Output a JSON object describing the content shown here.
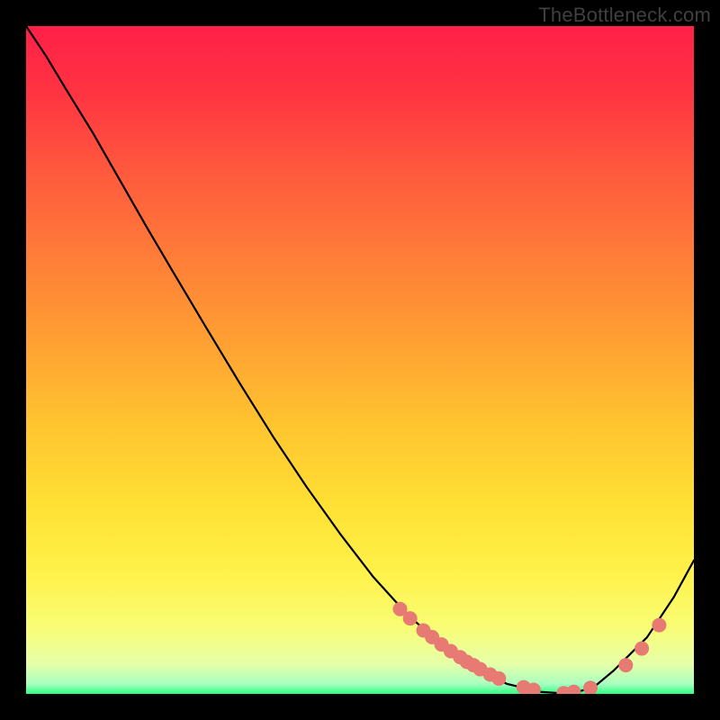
{
  "watermark": "TheBottleneck.com",
  "chart_data": {
    "type": "line",
    "title": "",
    "xlabel": "",
    "ylabel": "",
    "x": [
      0.0,
      0.03,
      0.06,
      0.1,
      0.14,
      0.18,
      0.22,
      0.27,
      0.32,
      0.37,
      0.42,
      0.47,
      0.52,
      0.57,
      0.62,
      0.67,
      0.72,
      0.77,
      0.815,
      0.85,
      0.88,
      0.93,
      0.97,
      1.0
    ],
    "values": [
      1.0,
      0.955,
      0.905,
      0.84,
      0.77,
      0.7,
      0.632,
      0.548,
      0.465,
      0.385,
      0.31,
      0.24,
      0.175,
      0.12,
      0.075,
      0.04,
      0.015,
      0.003,
      0.0,
      0.01,
      0.035,
      0.085,
      0.145,
      0.2
    ],
    "xlim": [
      0,
      1
    ],
    "ylim": [
      0,
      1
    ],
    "markers": {
      "x": [
        0.56,
        0.575,
        0.595,
        0.608,
        0.622,
        0.636,
        0.65,
        0.66,
        0.67,
        0.68,
        0.695,
        0.708,
        0.745,
        0.76,
        0.805,
        0.82,
        0.845,
        0.898,
        0.922,
        0.948
      ],
      "y": [
        0.127,
        0.113,
        0.095,
        0.085,
        0.074,
        0.064,
        0.055,
        0.048,
        0.043,
        0.037,
        0.029,
        0.023,
        0.01,
        0.006,
        0.001,
        0.003,
        0.009,
        0.043,
        0.068,
        0.103
      ],
      "color": "#e87a74",
      "r": 8
    },
    "gradient_stops": [
      {
        "offset": 0.0,
        "color": "#ff1f48"
      },
      {
        "offset": 0.1,
        "color": "#ff3442"
      },
      {
        "offset": 0.22,
        "color": "#ff5a3d"
      },
      {
        "offset": 0.35,
        "color": "#ff7e38"
      },
      {
        "offset": 0.48,
        "color": "#ffa232"
      },
      {
        "offset": 0.6,
        "color": "#ffc530"
      },
      {
        "offset": 0.72,
        "color": "#ffe134"
      },
      {
        "offset": 0.82,
        "color": "#fff24a"
      },
      {
        "offset": 0.9,
        "color": "#f9fd75"
      },
      {
        "offset": 0.955,
        "color": "#e6ffa8"
      },
      {
        "offset": 0.985,
        "color": "#a9ffc0"
      },
      {
        "offset": 1.0,
        "color": "#2cff83"
      }
    ]
  }
}
